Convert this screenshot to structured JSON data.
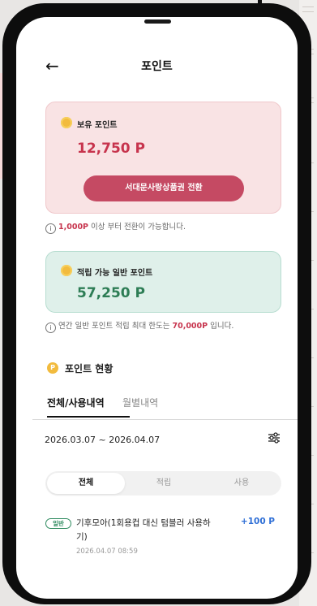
{
  "header": {
    "title": "포인트"
  },
  "held_points": {
    "label": "보유 포인트",
    "amount": "12,750 P",
    "convert_button": "서대문사랑상품권 전환"
  },
  "convert_note": {
    "highlight": "1,000P",
    "text": " 이상 부터 전환이 가능합니다."
  },
  "accumulable_points": {
    "label": "적립 가능 일반 포인트",
    "amount": "57,250 P"
  },
  "limit_note": {
    "prefix": "연간 일반 포인트 적립 최대 한도는 ",
    "highlight": "70,000P",
    "suffix": " 입니다."
  },
  "status": {
    "badge": "P",
    "title": "포인트 현황"
  },
  "tabs": {
    "active": "전체/사용내역",
    "inactive": "월별내역"
  },
  "filter": {
    "date_range": "2026.03.07 ~ 2026.04.07"
  },
  "segment": {
    "all": "전체",
    "earn": "적립",
    "use": "사용"
  },
  "transactions": [
    {
      "badge": "일반",
      "title": "기후모아(1회용컵 대신 텀블러 사용하기)",
      "amount": "+100 P",
      "date": "2026.04.07 08:59"
    }
  ],
  "colors": {
    "accent_red": "#c7344d",
    "button_red": "#c54a63",
    "accent_green": "#2d7d55",
    "amount_blue": "#2f6fd6"
  }
}
